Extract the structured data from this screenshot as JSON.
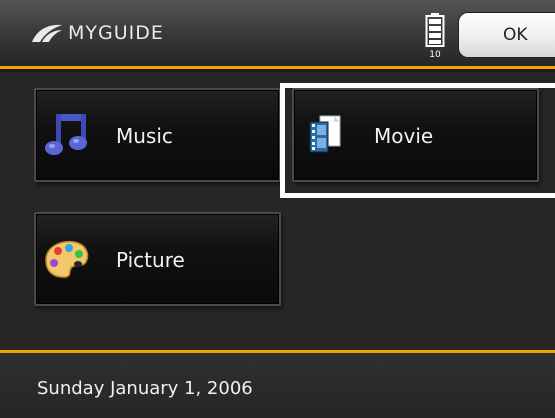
{
  "header": {
    "logo_text": "MYGUIDE",
    "battery_label": "10",
    "ok_label": "OK"
  },
  "menu": {
    "items": [
      {
        "label": "Music",
        "icon": "music-note-icon"
      },
      {
        "label": "Movie",
        "icon": "film-document-icon"
      },
      {
        "label": "Picture",
        "icon": "paint-palette-icon"
      }
    ],
    "selected": "Movie"
  },
  "footer": {
    "date": "Sunday January 1, 2006"
  },
  "colors": {
    "accent": "#f0a300",
    "background": "#262626",
    "tile": "#111111",
    "focus": "#ffffff"
  }
}
